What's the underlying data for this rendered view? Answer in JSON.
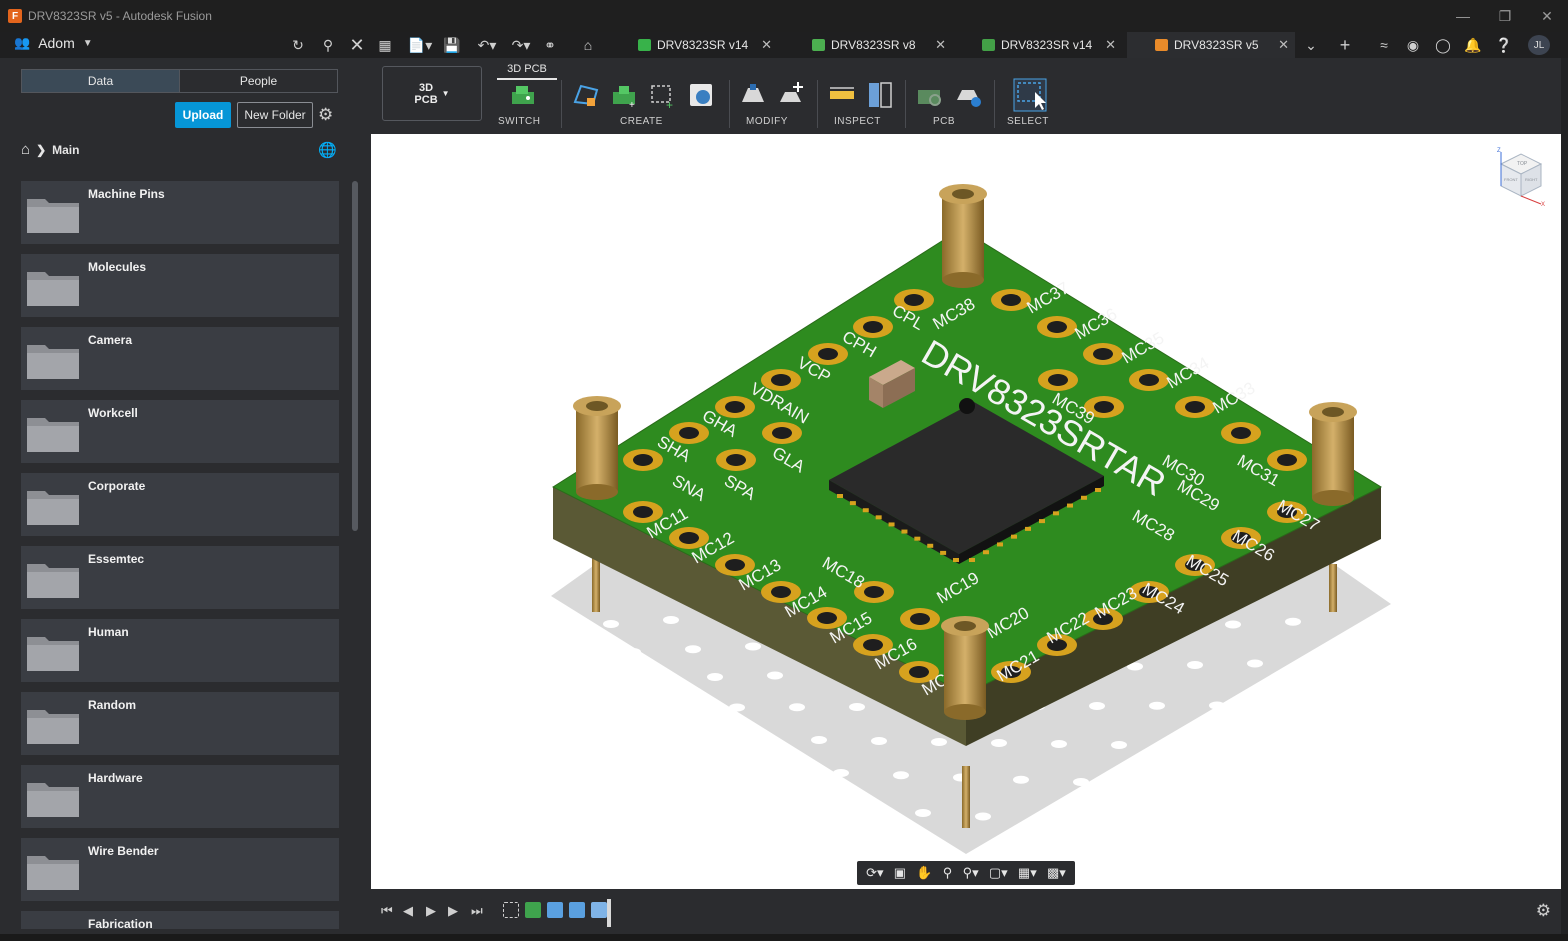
{
  "window": {
    "title": "DRV8323SR v5 - Autodesk Fusion",
    "minimize_icon": "minimize-icon",
    "restore_icon": "restore-icon",
    "close_icon": "close-icon"
  },
  "header": {
    "team_name": "Adom",
    "user_initials": "JL",
    "tabs": [
      {
        "label": "DRV8323SR v14",
        "icon": "pcb-doc-icon",
        "color": "#38b24a"
      },
      {
        "label": "DRV8323SR v8",
        "icon": "schematic-doc-icon",
        "color": "#4caf50"
      },
      {
        "label": "DRV8323SR v14",
        "icon": "board-doc-icon",
        "color": "#43a047"
      },
      {
        "label": "DRV8323SR v5",
        "icon": "3d-pcb-doc-icon",
        "color": "#e98b2a"
      }
    ]
  },
  "data_panel": {
    "tabs": [
      "Data",
      "People"
    ],
    "upload_label": "Upload",
    "new_folder_label": "New Folder",
    "breadcrumb": "Main",
    "folders": [
      "Machine Pins",
      "Molecules",
      "Camera",
      "Workcell",
      "Corporate",
      "Essemtec",
      "Human",
      "Random",
      "Hardware",
      "Wire Bender",
      "Fabrication"
    ]
  },
  "toolbar": {
    "workspace": [
      "3D",
      "PCB"
    ],
    "active_tab": "3D PCB",
    "groups": [
      "SWITCH",
      "CREATE",
      "MODIFY",
      "INSPECT",
      "PCB",
      "SELECT"
    ]
  },
  "board": {
    "title": "DRV8323SRTAR",
    "pads_left": [
      "CPL",
      "CPH",
      "VCP",
      "VDRAIN",
      "GHA",
      "SHA",
      "SNA",
      "GLA",
      "SPA"
    ],
    "pads_bottom": [
      "MC11",
      "MC12",
      "MC13",
      "MC14",
      "MC15",
      "MC16",
      "MC17",
      "MC18",
      "MC19",
      "MC20",
      "MC21",
      "MC22",
      "MC23"
    ],
    "pads_right": [
      "MC24",
      "MC25",
      "MC26",
      "MC27",
      "MC28",
      "MC29",
      "MC30",
      "MC31",
      "MC33",
      "MC34",
      "MC35",
      "MC36",
      "MC37",
      "MC38",
      "MC39"
    ],
    "colors": {
      "board": "#2e8b1f",
      "pad": "#d6a21e",
      "base": "#6b6a3a",
      "chip": "#2a2a2a"
    }
  },
  "viewcube": {
    "top": "TOP",
    "front": "FRONT",
    "right": "RIGHT",
    "x": "X",
    "z": "Z"
  }
}
